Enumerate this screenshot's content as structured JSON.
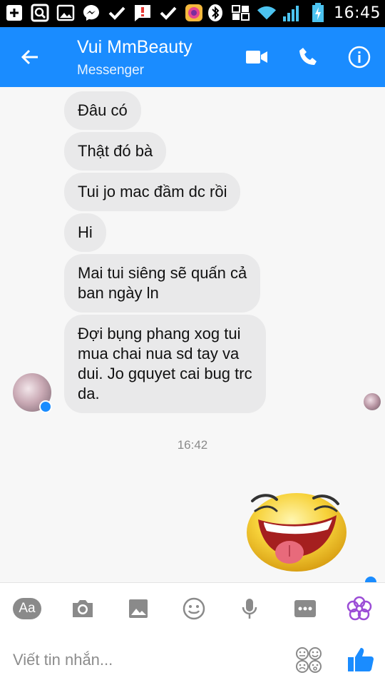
{
  "status_bar": {
    "time": "16:45",
    "left_icons": [
      "add-box-icon",
      "search-box-icon",
      "image-icon",
      "messenger-icon",
      "check-icon",
      "alert-chat-icon",
      "check-icon",
      "camera-app-icon"
    ],
    "right_icons": [
      "bluetooth-icon",
      "vibrate-icon",
      "wifi-icon",
      "signal-icon",
      "battery-charging-icon"
    ]
  },
  "header": {
    "title": "Vui MmBeauty",
    "subtitle": "Messenger",
    "back_icon": "arrow-left-icon",
    "actions": [
      "video-call-icon",
      "phone-icon",
      "info-icon"
    ],
    "color": "#1a8cff"
  },
  "messages": [
    {
      "text": "Đâu có"
    },
    {
      "text": "Thật đó bà"
    },
    {
      "text": "Tui jo mac đầm dc rồi"
    },
    {
      "text": "Hi"
    },
    {
      "text": "Mai tui siêng sẽ quấn cả\nban ngày ln"
    },
    {
      "text": "Đợi bụng phang xog tui\nmua chai nua sd tay va\ndui. Jo gquyet cai bug trc\nda."
    }
  ],
  "timestamp": "16:42",
  "toolbar": {
    "aa_label": "Aa",
    "icons": [
      "text-format-icon",
      "camera-icon",
      "gallery-icon",
      "emoji-icon",
      "microphone-icon",
      "more-icon",
      "flower-icon"
    ]
  },
  "composer": {
    "placeholder": "Viết tin nhắn...",
    "emoji_icon": "emoji-selector-icon",
    "like_icon": "thumbs-up-icon"
  },
  "colors": {
    "bubble": "#e9e9ea",
    "accent": "#1a8cff",
    "flower": "#9b4dd6"
  }
}
